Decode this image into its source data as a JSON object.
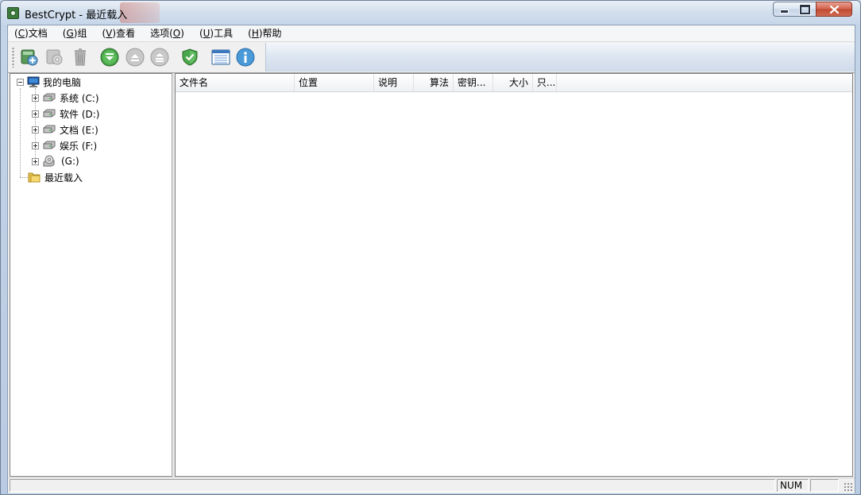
{
  "window": {
    "title": "BestCrypt - 最近载入"
  },
  "menu": {
    "items": [
      {
        "key": "C",
        "label": "文档"
      },
      {
        "key": "G",
        "label": "组"
      },
      {
        "key": "V",
        "label": "查看"
      },
      {
        "label_prefix": "选项",
        "key": "O"
      },
      {
        "key": "U",
        "label": "工具"
      },
      {
        "key": "H",
        "label": "帮助"
      }
    ]
  },
  "toolbar": {
    "buttons": [
      {
        "icon": "create-container-icon",
        "enabled": true
      },
      {
        "icon": "container-properties-icon",
        "enabled": false
      },
      {
        "icon": "delete-icon",
        "enabled": false
      },
      {
        "icon": "mount-icon",
        "enabled": true
      },
      {
        "icon": "dismount-icon",
        "enabled": false
      },
      {
        "icon": "dismount-all-icon",
        "enabled": false
      },
      {
        "icon": "shield-icon",
        "enabled": true
      },
      {
        "icon": "list-view-icon",
        "enabled": true
      },
      {
        "icon": "info-icon",
        "enabled": true
      }
    ]
  },
  "tree": {
    "root": "我的电脑",
    "drives": [
      {
        "label": "系统 (C:)",
        "icon": "hard-drive-icon"
      },
      {
        "label": "软件 (D:)",
        "icon": "hard-drive-icon"
      },
      {
        "label": "文档 (E:)",
        "icon": "hard-drive-icon"
      },
      {
        "label": "娱乐 (F:)",
        "icon": "hard-drive-icon"
      },
      {
        "label": "(G:)",
        "icon": "dvd-drive-icon"
      }
    ],
    "recent": "最近载入"
  },
  "list": {
    "columns": [
      "文件名",
      "位置",
      "说明",
      "算法",
      "密钥...",
      "大小",
      "只..."
    ],
    "rows": []
  },
  "statusbar": {
    "num": "NUM"
  },
  "colors": {
    "accent_green": "#3c9a3c",
    "title_bar": "#d4e0ee",
    "close_red": "#c14830"
  }
}
